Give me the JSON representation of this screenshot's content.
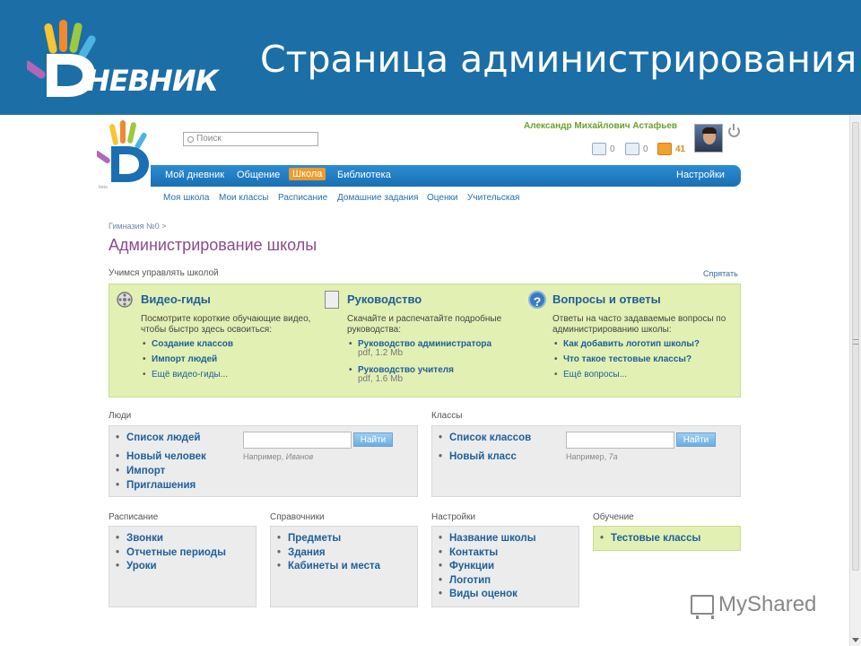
{
  "slide": {
    "logo_text": "НЕВНИК",
    "title": "Страница администрирования"
  },
  "header": {
    "search_placeholder": "Поиск",
    "user_name": "Александр Михайлович Астафьев",
    "notifications": [
      {
        "icon": "envelope-icon",
        "count": "0"
      },
      {
        "icon": "person-icon",
        "count": "0"
      },
      {
        "icon": "people-icon",
        "count": "41"
      }
    ]
  },
  "navbar": {
    "items": [
      "Мой дневник",
      "Общение",
      "Школа",
      "Библиотека"
    ],
    "active": "Школа",
    "settings": "Настройки"
  },
  "subnav": {
    "items": [
      "Моя школа",
      "Мои классы",
      "Расписание",
      "Домашние задания",
      "Оценки",
      "Учительская"
    ]
  },
  "page": {
    "breadcrumb": "Гимназия №0 >",
    "title": "Администрирование школы"
  },
  "learn": {
    "label": "Учимся управлять школой",
    "hide": "Спрятать",
    "video": {
      "title": "Видео-гиды",
      "desc": "Посмотрите короткие обучающие видео, чтобы быстро здесь освоиться:",
      "links": [
        "Создание классов",
        "Импорт людей",
        "Ещё видео-гиды..."
      ]
    },
    "guide": {
      "title": "Руководство",
      "desc": "Скачайте и распечатайте подробные руководства:",
      "links": [
        {
          "label": "Руководство администратора",
          "meta": "pdf, 1.2 Mb"
        },
        {
          "label": "Руководство учителя",
          "meta": "pdf, 1.6 Mb"
        }
      ]
    },
    "faq": {
      "title": "Вопросы и ответы",
      "desc": "Ответы на часто задаваемые вопросы по администрированию школы:",
      "links": [
        "Как добавить логотип школы?",
        "Что такое тестовые классы?",
        "Ещё вопросы..."
      ]
    }
  },
  "people": {
    "label": "Люди",
    "links": [
      "Список людей",
      "Новый человек",
      "Импорт",
      "Приглашения"
    ],
    "button": "Найти",
    "hint_prefix": "Например,",
    "hint_example": "Иванов"
  },
  "classes": {
    "label": "Классы",
    "links": [
      "Список классов",
      "Новый класс"
    ],
    "button": "Найти",
    "hint_prefix": "Например,",
    "hint_example": "7а"
  },
  "schedule": {
    "label": "Расписание",
    "links": [
      "Звонки",
      "Отчетные периоды",
      "Уроки"
    ]
  },
  "references": {
    "label": "Справочники",
    "links": [
      "Предметы",
      "Здания",
      "Кабинеты и места"
    ]
  },
  "settings": {
    "label": "Настройки",
    "links": [
      "Название школы",
      "Контакты",
      "Функции",
      "Логотип",
      "Виды оценок"
    ]
  },
  "training": {
    "label": "Обучение",
    "links": [
      "Тестовые классы"
    ]
  },
  "watermark": "MyShared",
  "colors": {
    "slide_blue": "#1c6fa6",
    "nav_blue": "#1a6fb3",
    "active_orange": "#f09a28",
    "link_blue": "#1d5f9a",
    "title_purple": "#8a4a8e",
    "green_panel": "#e3f0b4",
    "username_green": "#6aa12c"
  }
}
